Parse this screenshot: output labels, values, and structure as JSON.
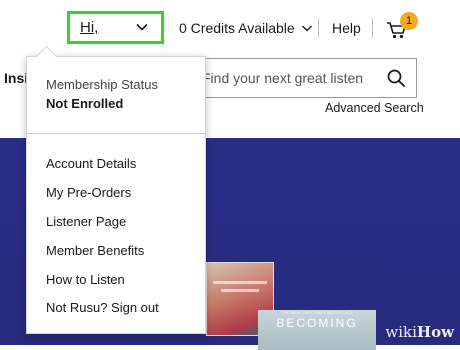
{
  "header": {
    "greeting": "Hi,",
    "credits_label": "0 Credits Available",
    "help_label": "Help",
    "cart_count": "1",
    "left_nav_partial": "Insi"
  },
  "search": {
    "placeholder": "Find your next great listen",
    "advanced_link": "Advanced Search"
  },
  "account_menu": {
    "status_label": "Membership Status",
    "status_value": "Not Enrolled",
    "items": [
      {
        "label": "Account Details"
      },
      {
        "label": "My Pre-Orders"
      },
      {
        "label": "Listener Page"
      },
      {
        "label": "Member Benefits"
      },
      {
        "label": "How to Listen"
      },
      {
        "label": "Not Rusu? Sign out"
      }
    ]
  },
  "hero": {
    "book_title": "BECOMING",
    "book_subtitle": "THE NEW YORK TIMES BESTSELLER"
  },
  "watermark": {
    "prefix": "wiki",
    "suffix": "How"
  },
  "colors": {
    "highlight_border": "#33d624",
    "hero_background": "#2a2e86",
    "badge": "#f5a623"
  },
  "icons": [
    "chevron-down-icon",
    "cart-icon",
    "search-icon"
  ]
}
